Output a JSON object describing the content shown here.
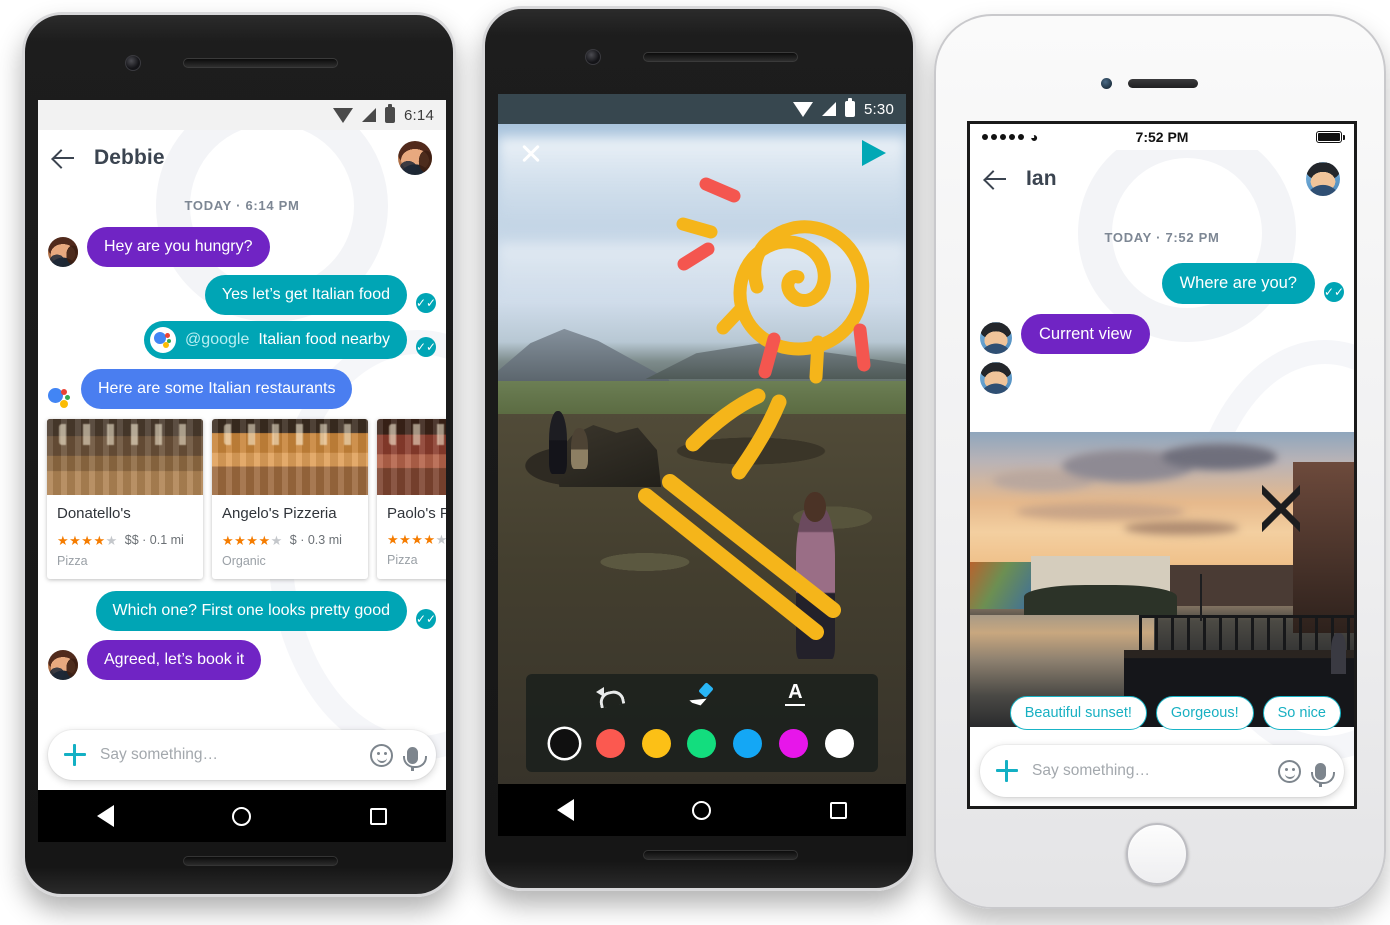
{
  "phone1": {
    "device": "android-black",
    "status": {
      "time": "6:14",
      "icons": [
        "wifi-icon",
        "signal-icon",
        "battery-icon"
      ]
    },
    "appbar": {
      "back_icon": "back-arrow-icon",
      "title": "Debbie",
      "avatar": "debbie-avatar"
    },
    "daystamp": "TODAY · 6:14 PM",
    "messages": [
      {
        "id": "m1",
        "dir": "in",
        "text": "Hey are you hungry?",
        "avatar": "debbie-avatar"
      },
      {
        "id": "m2",
        "dir": "out",
        "text": "Yes let’s get Italian food",
        "ticks": true
      },
      {
        "id": "m3",
        "dir": "out",
        "mention": "@google",
        "text": "Italian food nearby",
        "assistant_badge": true,
        "ticks": true
      },
      {
        "id": "m4",
        "dir": "assistant",
        "text": "Here are some Italian restaurants",
        "assistant_dots": true
      },
      {
        "id": "m5",
        "dir": "out",
        "text": "Which one? First one looks pretty good",
        "ticks": true
      },
      {
        "id": "m6",
        "dir": "in",
        "text": "Agreed, let’s book it",
        "avatar": "debbie-avatar"
      }
    ],
    "cards": [
      {
        "name": "Donatello's",
        "stars": 4,
        "max_stars": 5,
        "price": "$$",
        "distance": "0.1 mi",
        "meta": "$$ · 0.1 mi",
        "category": "Pizza",
        "image": "restaurant-interior-1"
      },
      {
        "name": "Angelo's Pizzeria",
        "stars": 4,
        "max_stars": 5,
        "price": "$",
        "distance": "0.3 mi",
        "meta": "$ · 0.3 mi",
        "category": "Organic",
        "image": "restaurant-interior-2"
      },
      {
        "name": "Paolo's Piz",
        "stars": 4,
        "max_stars": 5,
        "price": "",
        "distance": "",
        "meta": "",
        "category": "Pizza",
        "image": "restaurant-interior-3",
        "truncated": true
      }
    ],
    "composer": {
      "plus_icon": "plus-icon",
      "placeholder": "Say something…",
      "emoji_icon": "emoji-icon",
      "mic_icon": "microphone-icon"
    },
    "navbar": {
      "back": "nav-back-icon",
      "home": "nav-home-icon",
      "recents": "nav-recents-icon"
    }
  },
  "phone2": {
    "device": "android-black",
    "status": {
      "time": "5:30",
      "icons": [
        "wifi-icon",
        "signal-icon",
        "battery-icon"
      ]
    },
    "topbar": {
      "close_icon": "close-icon",
      "send_icon": "send-icon"
    },
    "photo": {
      "description": "Iceland volcanic landscape with hikers"
    },
    "doodle": {
      "description": "hand-drawn sun with spiral and rays",
      "colors": [
        "#f5b51a",
        "#f4564f"
      ]
    },
    "toolbar": {
      "tools": [
        {
          "name": "undo-tool",
          "icon": "undo-icon"
        },
        {
          "name": "pen-tool",
          "icon": "pen-icon"
        },
        {
          "name": "text-tool",
          "icon": "text-icon"
        }
      ],
      "colors": [
        {
          "name": "black",
          "hex": "#101010",
          "selected": true
        },
        {
          "name": "red",
          "hex": "#fb5950",
          "selected": false
        },
        {
          "name": "yellow",
          "hex": "#fcc016",
          "selected": false
        },
        {
          "name": "green",
          "hex": "#13dd7e",
          "selected": false
        },
        {
          "name": "blue",
          "hex": "#14a7f5",
          "selected": false
        },
        {
          "name": "magenta",
          "hex": "#e716ea",
          "selected": false
        },
        {
          "name": "white",
          "hex": "#ffffff",
          "selected": false
        }
      ]
    },
    "navbar": {
      "back": "nav-back-icon",
      "home": "nav-home-icon",
      "recents": "nav-recents-icon"
    }
  },
  "phone3": {
    "device": "iphone-white",
    "status": {
      "signal_dots": 5,
      "wifi_icon": "wifi-icon",
      "time": "7:52 PM",
      "battery_icon": "battery-icon"
    },
    "appbar": {
      "back_icon": "back-arrow-icon",
      "title": "Ian",
      "avatar": "ian-avatar"
    },
    "daystamp": "TODAY · 7:52 PM",
    "messages": [
      {
        "id": "n1",
        "dir": "out",
        "text": "Where are you?",
        "ticks": true
      },
      {
        "id": "n2",
        "dir": "in",
        "text": "Current view",
        "avatar": "ian-avatar"
      },
      {
        "id": "n3",
        "dir": "in",
        "type": "photo",
        "description": "city canal at sunset",
        "avatar": "ian-avatar"
      }
    ],
    "smart_replies": [
      {
        "label": "Beautiful sunset!"
      },
      {
        "label": "Gorgeous!"
      },
      {
        "label": "So nice"
      }
    ],
    "composer": {
      "plus_icon": "plus-icon",
      "placeholder": "Say something…",
      "emoji_icon": "emoji-icon",
      "mic_icon": "microphone-icon"
    }
  },
  "theme": {
    "teal": "#00a5b5",
    "purple": "#7024c4",
    "assistant_blue": "#4a7ef0",
    "chip_border": "#19b4c6",
    "star_orange": "#f57c00",
    "appbar_text": "#3b4450"
  }
}
